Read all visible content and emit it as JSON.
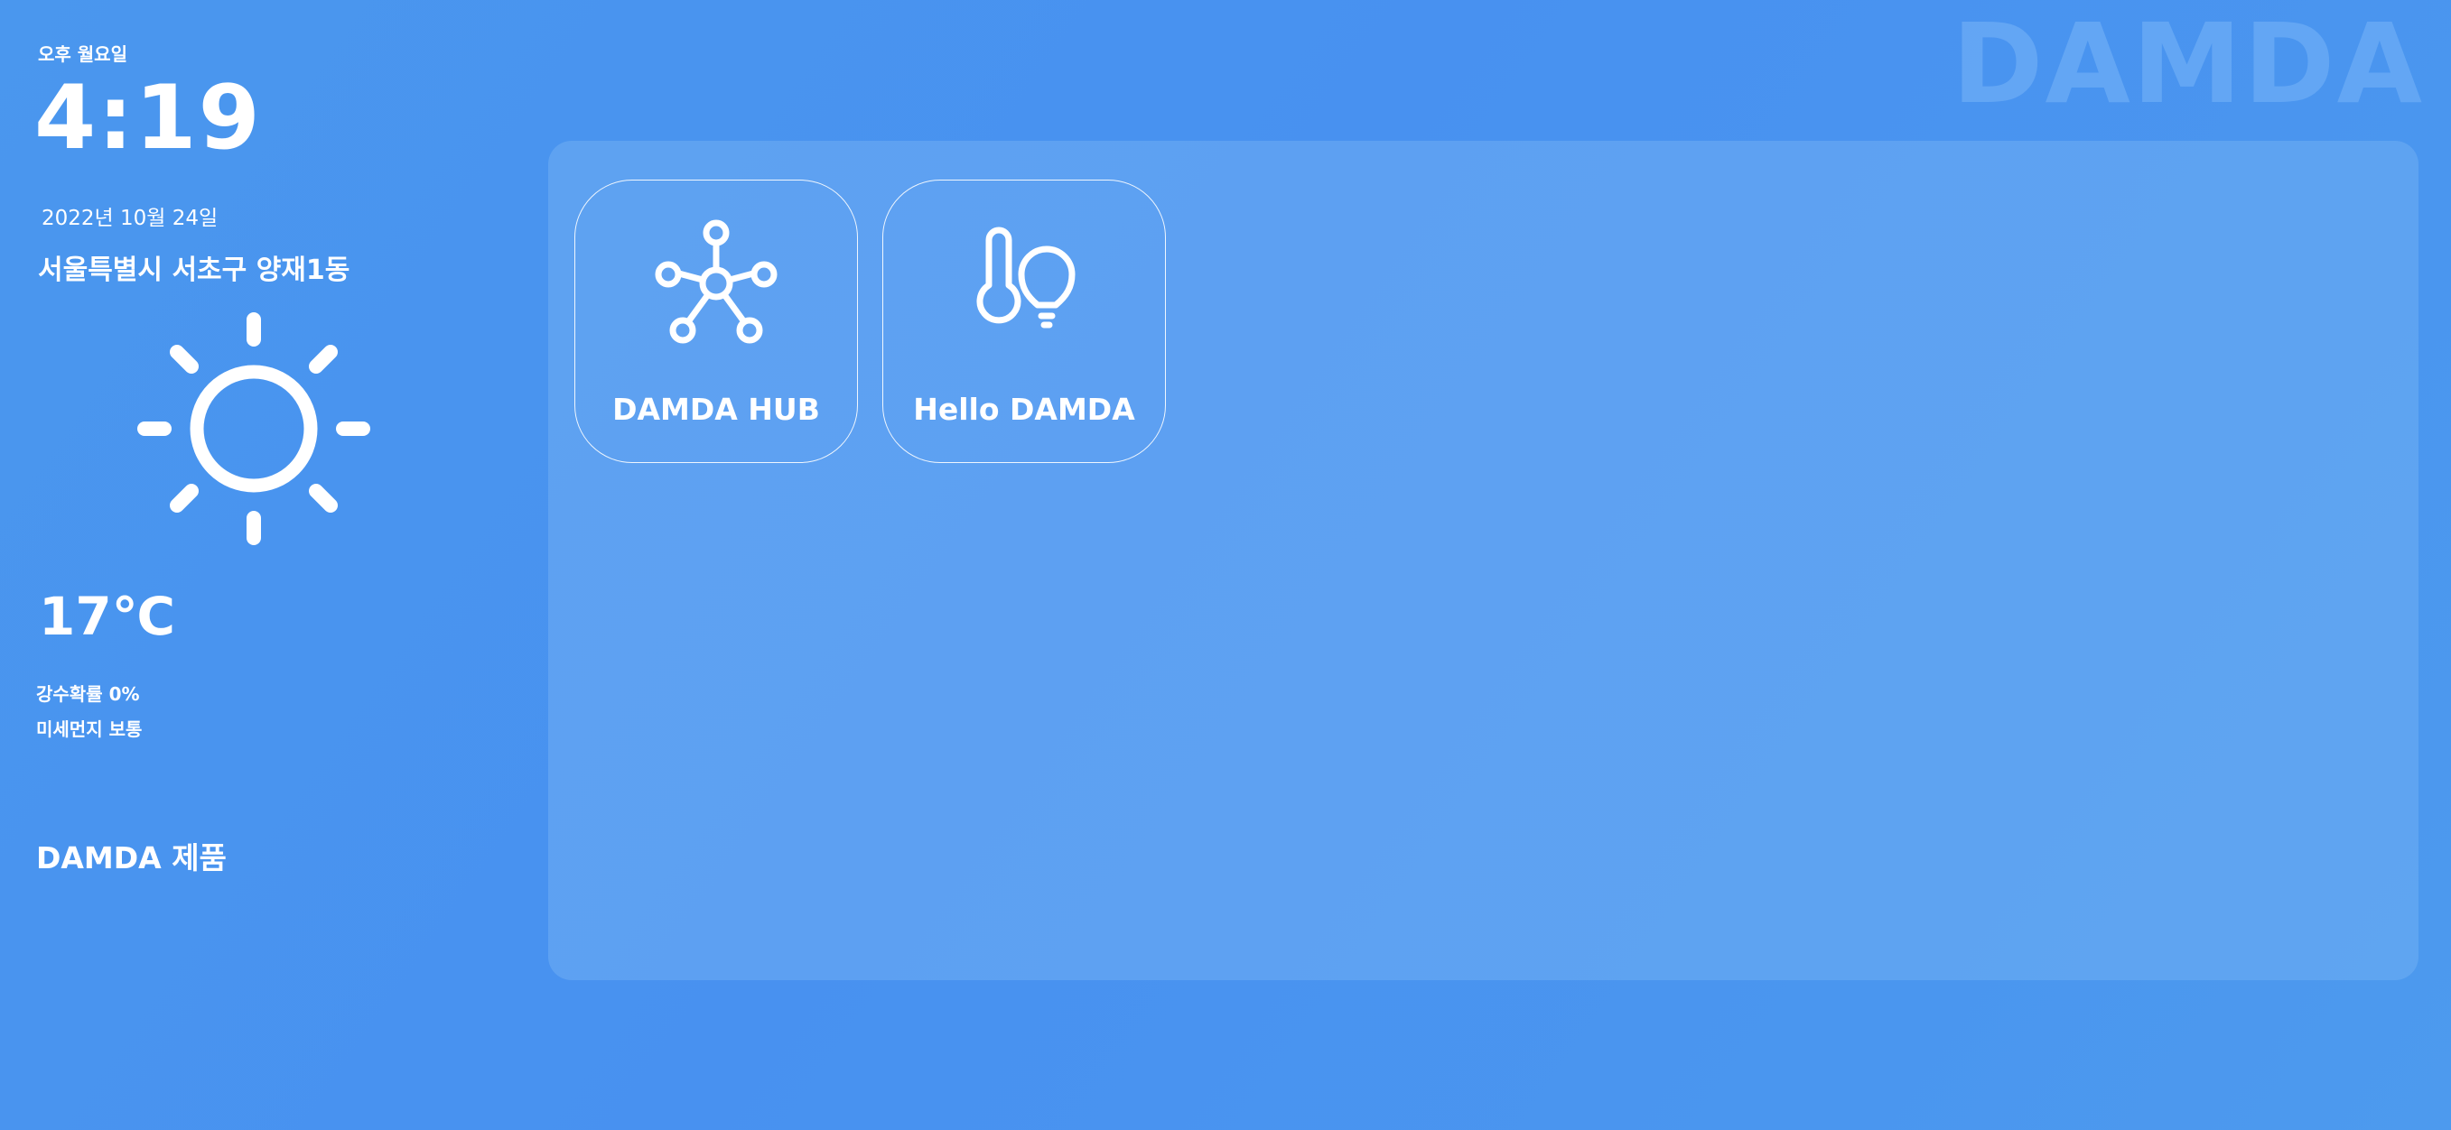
{
  "brand": {
    "watermark": "DAMDA"
  },
  "clock": {
    "ampm_day": "오후 월요일",
    "time": "4:19",
    "date": "2022년 10월 24일"
  },
  "weather": {
    "location": "서울특별시 서초구 양재1동",
    "icon": "sun-icon",
    "temperature": "17℃",
    "rain_probability": "강수확률 0%",
    "fine_dust": "미세먼지 보통"
  },
  "products": {
    "heading": "DAMDA 제품",
    "apps": [
      {
        "label": "DAMDA HUB",
        "icon": "hub-network-icon"
      },
      {
        "label": "Hello DAMDA",
        "icon": "thermometer-bulb-icon"
      }
    ]
  },
  "colors": {
    "background": "#4891f0",
    "panel": "#6aa8f3",
    "text": "#ffffff",
    "watermark": "#78b4f8"
  }
}
